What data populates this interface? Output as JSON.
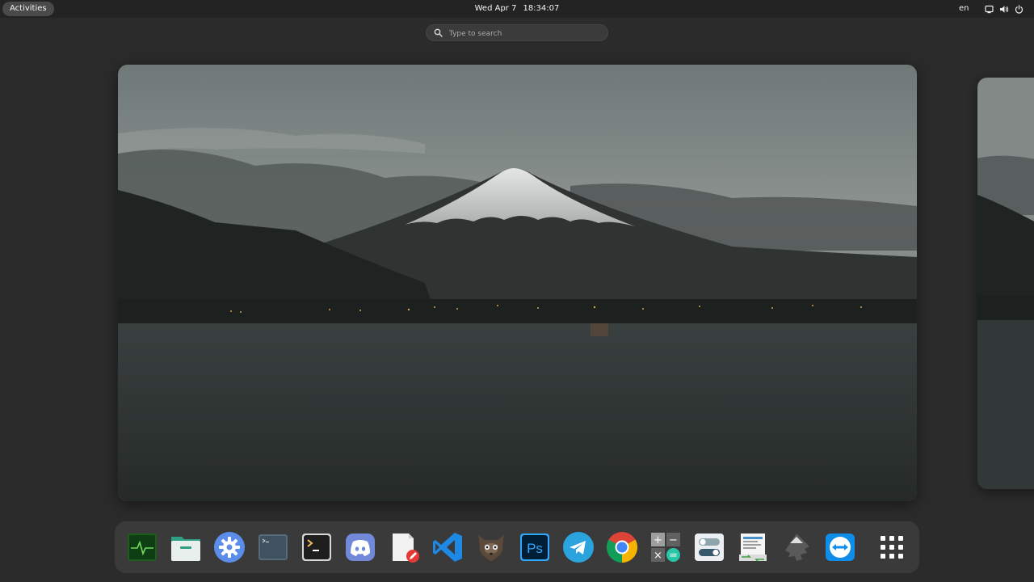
{
  "topbar": {
    "activities_label": "Activities",
    "date": "Wed Apr 7",
    "time": "18:34:07",
    "language": "en",
    "tray_icons": [
      "screen-icon",
      "volume-icon",
      "power-icon"
    ]
  },
  "search": {
    "placeholder": "Type to search",
    "icon": "search-icon"
  },
  "wallpaper": {
    "subject": "snow-capped mountain over lake at dusk"
  },
  "dock": {
    "apps": [
      {
        "id": "system-monitor",
        "icon": "activity-monitor-icon"
      },
      {
        "id": "files",
        "icon": "folder-icon"
      },
      {
        "id": "settings",
        "icon": "gear-icon"
      },
      {
        "id": "console",
        "icon": "console-icon"
      },
      {
        "id": "terminal",
        "icon": "terminal-icon"
      },
      {
        "id": "discord",
        "icon": "discord-icon"
      },
      {
        "id": "text-editor",
        "icon": "text-editor-icon"
      },
      {
        "id": "vscode",
        "icon": "vscode-icon"
      },
      {
        "id": "gimp",
        "icon": "gimp-icon"
      },
      {
        "id": "photoshop",
        "icon": "photoshop-icon",
        "label": "Ps"
      },
      {
        "id": "telegram",
        "icon": "telegram-icon"
      },
      {
        "id": "chrome",
        "icon": "chrome-icon"
      },
      {
        "id": "calculator",
        "icon": "calculator-icon",
        "label_glyphs": [
          "+",
          "−",
          "×",
          "="
        ]
      },
      {
        "id": "tweaks",
        "icon": "toggle-switches-icon"
      },
      {
        "id": "connection-editor",
        "icon": "remote-transfer-icon"
      },
      {
        "id": "inkscape",
        "icon": "inkscape-icon"
      },
      {
        "id": "teamviewer",
        "icon": "teamviewer-icon"
      },
      {
        "id": "show-apps",
        "icon": "app-grid-icon"
      }
    ]
  },
  "colors": {
    "panel": "#232323",
    "background": "#2b2b2b",
    "dock": "#3a3a3a",
    "search": "#3b3b3b"
  }
}
